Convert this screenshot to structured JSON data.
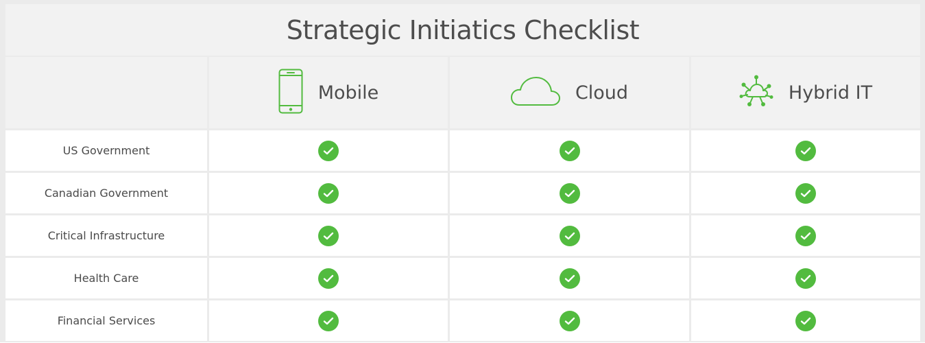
{
  "title": "Strategic Initiatics Checklist",
  "accent_color": "#52bb3f",
  "columns": [
    {
      "label": "Mobile",
      "icon": "mobile-phone-icon"
    },
    {
      "label": "Cloud",
      "icon": "cloud-icon"
    },
    {
      "label": "Hybrid IT",
      "icon": "hybrid-network-cloud-icon"
    }
  ],
  "rows": [
    {
      "label": "US Government",
      "checks": [
        true,
        true,
        true
      ]
    },
    {
      "label": "Canadian Government",
      "checks": [
        true,
        true,
        true
      ]
    },
    {
      "label": "Critical Infrastructure",
      "checks": [
        true,
        true,
        true
      ]
    },
    {
      "label": "Health Care",
      "checks": [
        true,
        true,
        true
      ]
    },
    {
      "label": "Financial Services",
      "checks": [
        true,
        true,
        true
      ]
    }
  ]
}
